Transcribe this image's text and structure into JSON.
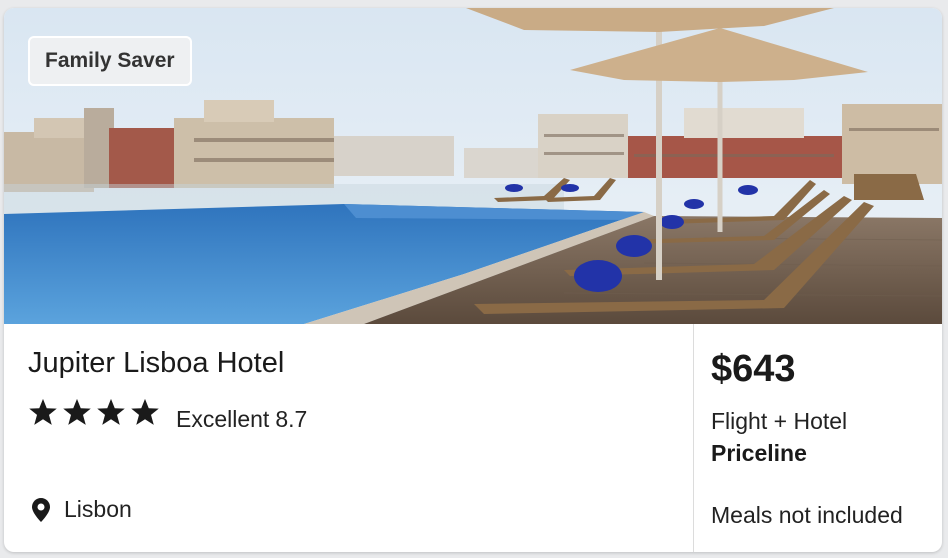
{
  "card": {
    "badge": "Family Saver",
    "photo": {
      "description_icon": "hotel-pool-photo"
    },
    "hotel": {
      "name": "Jupiter Lisboa Hotel",
      "stars": 4,
      "rating_label": "Excellent",
      "rating_score": "8.7",
      "location": "Lisbon",
      "location_icon": "map-pin-icon"
    },
    "offer": {
      "price": "$643",
      "package": "Flight + Hotel",
      "provider": "Priceline",
      "meals": "Meals not included"
    }
  },
  "colors": {
    "card_bg": "#ffffff",
    "page_bg": "#e9eaec",
    "badge_bg": "#eef0f2",
    "text": "#1a1a1a",
    "pool": "#3e8fd0"
  }
}
